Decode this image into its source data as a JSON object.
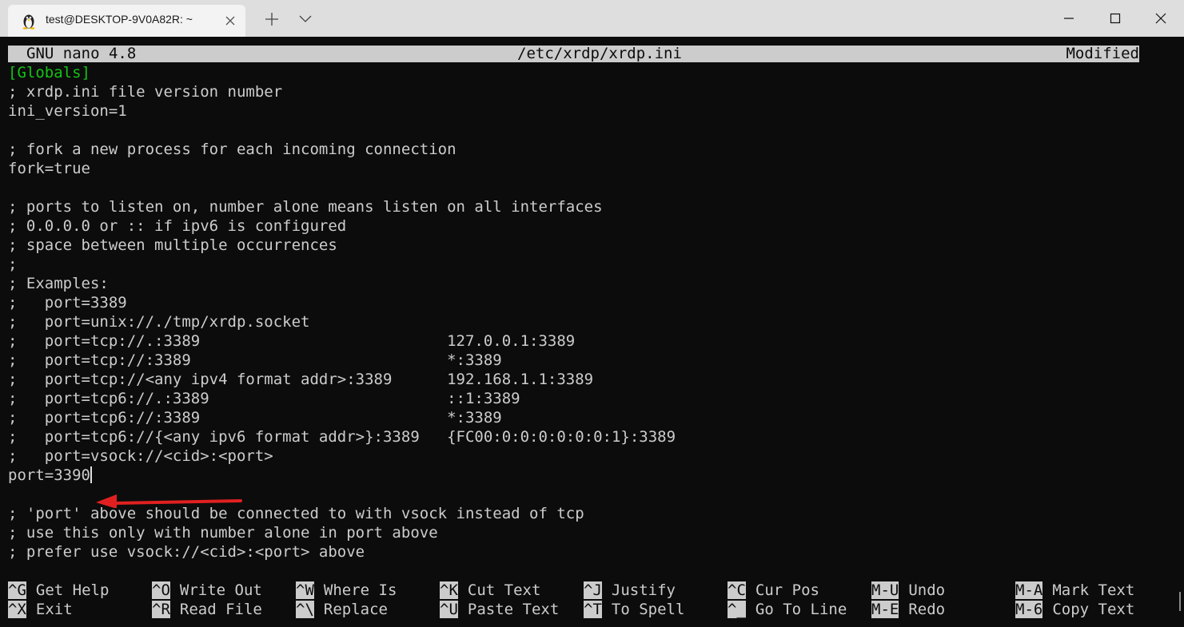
{
  "window": {
    "tab_title": "test@DESKTOP-9V0A82R: ~",
    "tab_icon": "linux-tux-icon"
  },
  "colors": {
    "terminal_bg": "#0c0c0c",
    "text": "#cccccc",
    "section_green": "#13c313",
    "arrow_red": "#e02020"
  },
  "nano": {
    "app": "GNU nano 4.8",
    "file": "/etc/xrdp/xrdp.ini",
    "status": "Modified"
  },
  "editor_lines": [
    "[Globals]",
    "; xrdp.ini file version number",
    "ini_version=1",
    "",
    "; fork a new process for each incoming connection",
    "fork=true",
    "",
    "; ports to listen on, number alone means listen on all interfaces",
    "; 0.0.0.0 or :: if ipv6 is configured",
    "; space between multiple occurrences",
    ";",
    "; Examples:",
    ";   port=3389",
    ";   port=unix://./tmp/xrdp.socket",
    ";   port=tcp://.:3389                           127.0.0.1:3389",
    ";   port=tcp://:3389                            *:3389",
    ";   port=tcp://<any ipv4 format addr>:3389      192.168.1.1:3389",
    ";   port=tcp6://.:3389                          ::1:3389",
    ";   port=tcp6://:3389                           *:3389",
    ";   port=tcp6://{<any ipv6 format addr>}:3389   {FC00:0:0:0:0:0:0:1}:3389",
    ";   port=vsock://<cid>:<port>",
    "port=3390",
    "",
    "; 'port' above should be connected to with vsock instead of tcp",
    "; use this only with number alone in port above",
    "; prefer use vsock://<cid>:<port> above"
  ],
  "shortcuts": [
    {
      "key": "^G",
      "label": "Get Help"
    },
    {
      "key": "^O",
      "label": "Write Out"
    },
    {
      "key": "^W",
      "label": "Where Is"
    },
    {
      "key": "^K",
      "label": "Cut Text"
    },
    {
      "key": "^J",
      "label": "Justify"
    },
    {
      "key": "^C",
      "label": "Cur Pos"
    },
    {
      "key": "M-U",
      "label": "Undo"
    },
    {
      "key": "M-A",
      "label": "Mark Text"
    },
    {
      "key": "^X",
      "label": "Exit"
    },
    {
      "key": "^R",
      "label": "Read File"
    },
    {
      "key": "^\\",
      "label": "Replace"
    },
    {
      "key": "^U",
      "label": "Paste Text"
    },
    {
      "key": "^T",
      "label": "To Spell"
    },
    {
      "key": "^_",
      "label": "Go To Line"
    },
    {
      "key": "M-E",
      "label": "Redo"
    },
    {
      "key": "M-6",
      "label": "Copy Text"
    }
  ]
}
